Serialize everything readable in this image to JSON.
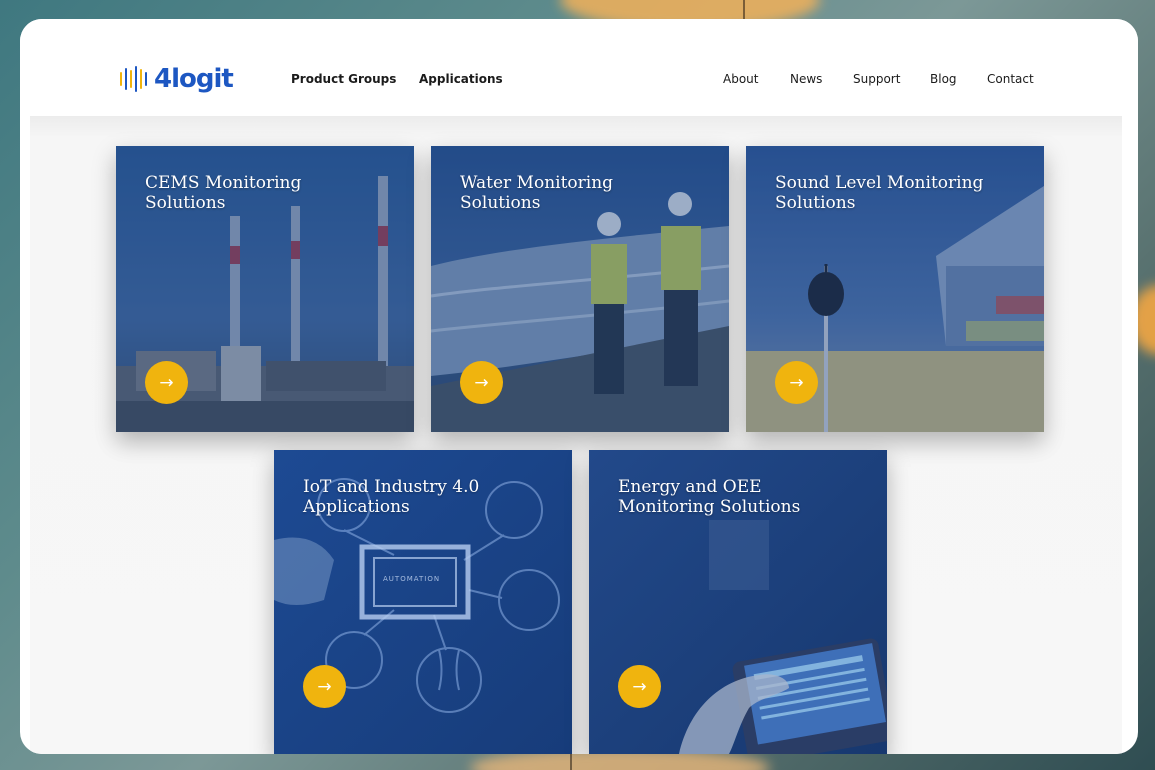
{
  "brand": {
    "name": "4logit",
    "colors": {
      "logo_blue": "#1d57c2",
      "bar_yellow": "#f0b40e",
      "bar_blue": "#1d57c2",
      "card_blue": "#1f4b8f",
      "accent_button": "#f0b40e"
    }
  },
  "nav": {
    "left": [
      "Product Groups",
      "Applications"
    ],
    "right": [
      "About",
      "News",
      "Support",
      "Blog",
      "Contact"
    ]
  },
  "cards": [
    {
      "title_line1": "CEMS Monitoring",
      "title_line2": "Solutions",
      "arrow": "→",
      "icon": "arrow-right-icon"
    },
    {
      "title_line1": "Water Monitoring",
      "title_line2": "Solutions",
      "arrow": "→",
      "icon": "arrow-right-icon"
    },
    {
      "title_line1": "Sound Level Monitoring",
      "title_line2": "Solutions",
      "arrow": "→",
      "icon": "arrow-right-icon"
    },
    {
      "title_line1": "IoT and Industry 4.0",
      "title_line2": "Applications",
      "arrow": "→",
      "icon": "arrow-right-icon"
    },
    {
      "title_line1": "Energy and OEE",
      "title_line2": "Monitoring Solutions",
      "arrow": "→",
      "icon": "arrow-right-icon"
    }
  ],
  "iot_card_label": "AUTOMATION"
}
